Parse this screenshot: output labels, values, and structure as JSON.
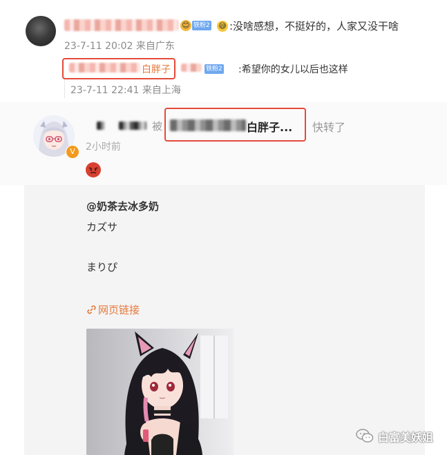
{
  "comment": {
    "badge": "铁粉2",
    "emoji": "😅",
    "text": ":没啥感想，不挺好的，人家又没干啥",
    "time": "23-7-11 20:02",
    "location": "来自广东"
  },
  "reply": {
    "name_visible": "白胖子",
    "badge": "铁粉2",
    "text": ":希望你的女儿以后也这样",
    "time": "23-7-11 22:41",
    "location": "来自上海"
  },
  "repost": {
    "by_label": "被",
    "highlighted_name": "白胖子...",
    "action": "快转了",
    "time": "2小时前"
  },
  "post": {
    "author": "@奶茶去冰多奶",
    "line1": "カズサ",
    "line2": "まりぴ",
    "link_icon": "link-icon",
    "link_text": "网页链接"
  },
  "watermark": {
    "text": "白富美妖姐"
  },
  "colors": {
    "highlight_border": "#e5493a",
    "link": "#e6783a",
    "badge": "#6fa8ef",
    "verified": "#f39a1e"
  }
}
